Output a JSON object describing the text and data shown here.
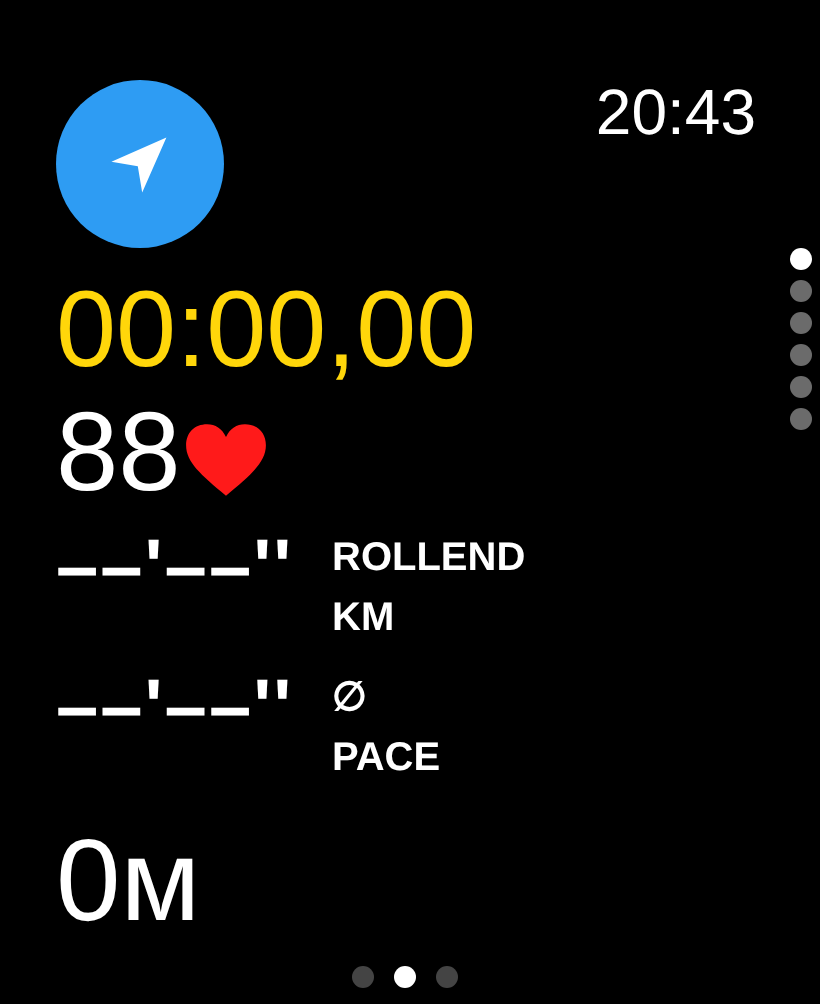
{
  "time": "20:43",
  "elapsed": "00:00,00",
  "heart_rate": "88",
  "metrics": [
    {
      "value": "––'––''",
      "label_lines": [
        "ROLLEND",
        "KM"
      ]
    },
    {
      "value": "––'––''",
      "label_lines": [
        "∅",
        "PACE"
      ]
    }
  ],
  "distance": "0м",
  "vertical_pages": [
    {
      "selected": true
    },
    {
      "selected": false
    },
    {
      "selected": false
    },
    {
      "selected": false
    },
    {
      "selected": false
    },
    {
      "selected": false
    }
  ],
  "horizontal_pages": [
    {
      "selected": false
    },
    {
      "selected": true
    },
    {
      "selected": false
    }
  ]
}
